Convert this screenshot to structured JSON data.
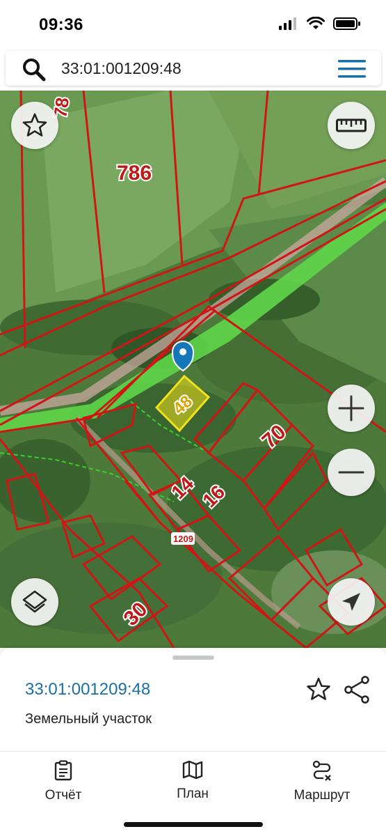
{
  "status_bar": {
    "time": "09:36",
    "icons": [
      "cellular-signal-icon",
      "wifi-icon",
      "battery-icon"
    ]
  },
  "search": {
    "value": "33:01:001209:48",
    "icon": "search-icon",
    "menu_icon": "hamburger-menu-icon",
    "accent_color": "#1a6fa8"
  },
  "map": {
    "parcel_labels": {
      "p786": "786",
      "p78": "78",
      "p70": "70",
      "p14": "14",
      "p16": "16",
      "p30": "30",
      "p48": "48",
      "block": "1209"
    },
    "colors": {
      "boundary": "#d01515",
      "selected_fill": "#f2e21b",
      "road_strip": "#5fd64a",
      "marker": "#1576b8"
    },
    "controls": [
      "favorite-star-icon",
      "ruler-icon",
      "zoom-in-icon",
      "zoom-out-icon",
      "layers-icon",
      "locate-arrow-icon"
    ]
  },
  "sheet": {
    "title": "33:01:001209:48",
    "subtitle": "Земельный участок",
    "actions": [
      "star-icon",
      "share-icon"
    ]
  },
  "tabs": [
    {
      "label": "Отчёт",
      "icon": "clipboard-icon"
    },
    {
      "label": "План",
      "icon": "map-icon"
    },
    {
      "label": "Маршрут",
      "icon": "route-icon"
    }
  ]
}
